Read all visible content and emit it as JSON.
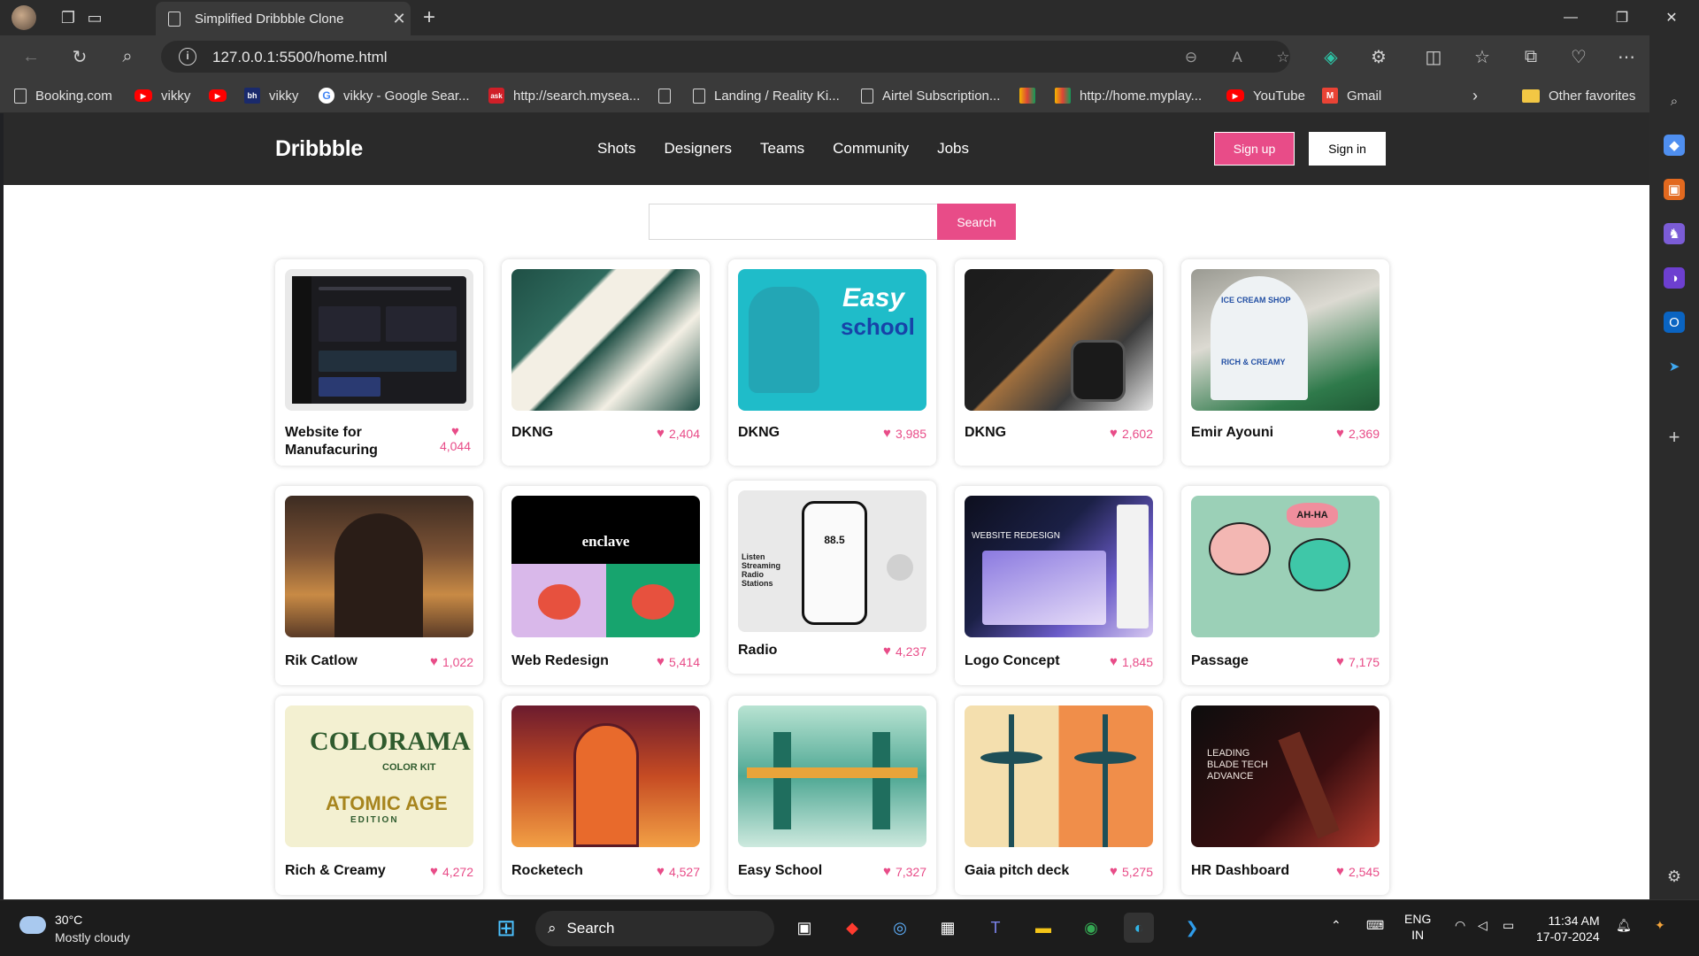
{
  "browser": {
    "tab_title": "Simplified Dribbble Clone",
    "url": "127.0.0.1:5500/home.html",
    "bookmarks": [
      {
        "label": "Booking.com",
        "icon": "doc-icon"
      },
      {
        "label": "vikky",
        "icon": "youtube-icon"
      },
      {
        "label": "",
        "icon": "youtube-icon"
      },
      {
        "label": "vikky",
        "icon": "bh-icon"
      },
      {
        "label": "vikky - Google Sear...",
        "icon": "google-icon"
      },
      {
        "label": "http://search.mysea...",
        "icon": "ask-icon"
      },
      {
        "label": "",
        "icon": "doc-icon"
      },
      {
        "label": "Landing / Reality Ki...",
        "icon": "doc-icon"
      },
      {
        "label": "Airtel Subscription...",
        "icon": "doc-icon"
      },
      {
        "label": "",
        "icon": "myplay-icon"
      },
      {
        "label": "http://home.myplay...",
        "icon": "myplay-icon"
      },
      {
        "label": "YouTube",
        "icon": "youtube-icon"
      },
      {
        "label": "Gmail",
        "icon": "gmail-icon"
      }
    ],
    "other_favorites": "Other favorites"
  },
  "site": {
    "logo": "Dribbble",
    "nav": [
      "Shots",
      "Designers",
      "Teams",
      "Community",
      "Jobs"
    ],
    "signup": "Sign up",
    "signin": "Sign in",
    "search_button": "Search",
    "search_placeholder": "",
    "accent_color": "#e84c88"
  },
  "shots": [
    {
      "name": "Website for Manufacuring",
      "likes": "4,044"
    },
    {
      "name": "DKNG",
      "likes": "2,404"
    },
    {
      "name": "DKNG",
      "likes": "3,985"
    },
    {
      "name": "DKNG",
      "likes": "2,602"
    },
    {
      "name": "Emir Ayouni",
      "likes": "2,369"
    },
    {
      "name": "Rik Catlow",
      "likes": "1,022"
    },
    {
      "name": "Web Redesign",
      "likes": "5,414"
    },
    {
      "name": "Radio",
      "likes": "4,237"
    },
    {
      "name": "Logo Concept",
      "likes": "1,845"
    },
    {
      "name": "Passage",
      "likes": "7,175"
    },
    {
      "name": "Rich & Creamy",
      "likes": "4,272"
    },
    {
      "name": "Rocketech",
      "likes": "4,527"
    },
    {
      "name": "Easy School",
      "likes": "7,327"
    },
    {
      "name": "Gaia pitch deck",
      "likes": "5,275"
    },
    {
      "name": "HR Dashboard",
      "likes": "2,545"
    }
  ],
  "thumb_text": {
    "easy": "Easy",
    "school": "school",
    "enclave": "enclave",
    "radio_freq": "88.5",
    "radio_side": "Listen Streaming Radio Stations",
    "web_redesign_sub": "WEBSITE REDESIGN",
    "colorama": "COLORAMA",
    "color_kit": "COLOR KIT",
    "atomic": "ATOMIC AGE",
    "edition": "EDITION",
    "blade": "LEADING BLADE TECH ADVANCE",
    "ice_cream": "ICE CREAM SHOP",
    "rich_creamy": "RICH & CREAMY",
    "ahha": "AH-HA"
  },
  "taskbar": {
    "temp": "30°C",
    "weather": "Mostly cloudy",
    "search": "Search",
    "lang_top": "ENG",
    "lang_bottom": "IN",
    "time": "11:34 AM",
    "date": "17-07-2024"
  }
}
